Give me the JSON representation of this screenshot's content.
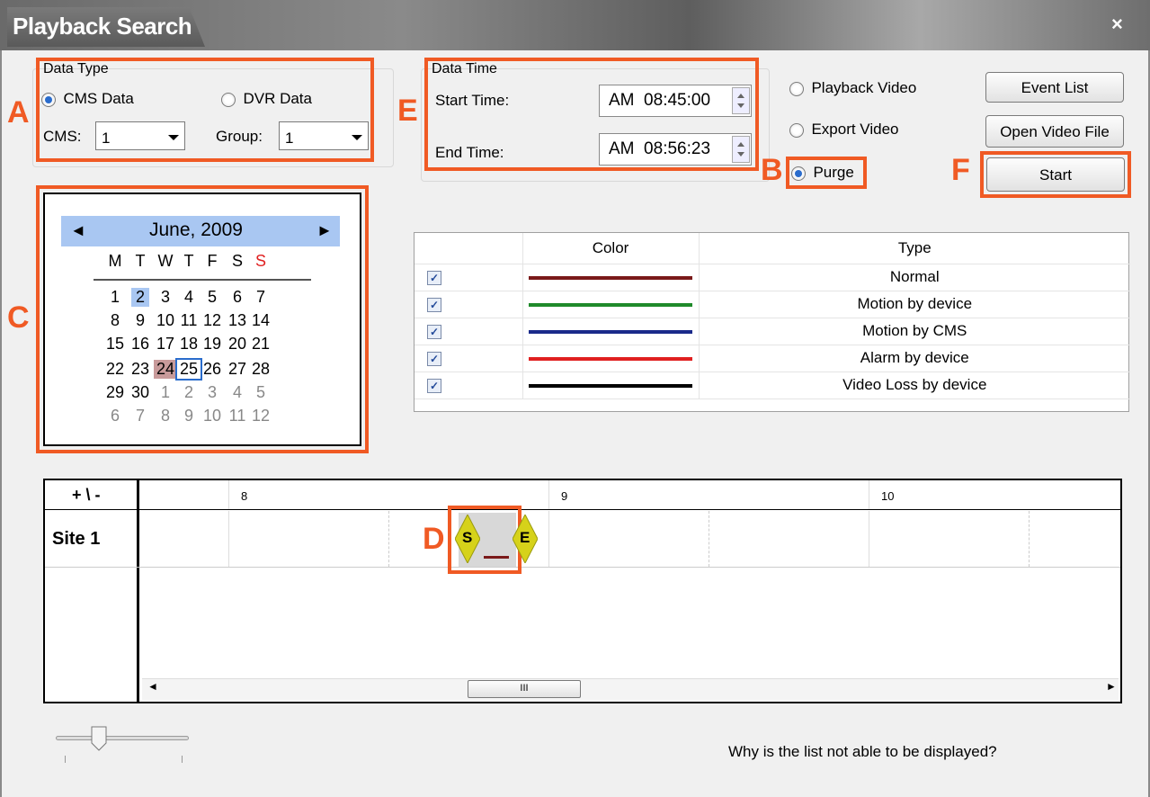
{
  "window": {
    "title": "Playback Search",
    "close": "×"
  },
  "data_type": {
    "legend": "Data Type",
    "cms_data": "CMS Data",
    "dvr_data": "DVR Data",
    "cms_label": "CMS:",
    "cms_value": "1",
    "group_label": "Group:",
    "group_value": "1"
  },
  "data_time": {
    "legend": "Data Time",
    "start_label": "Start Time:",
    "start_value": "AM  08:45:00",
    "end_label": "End Time:",
    "end_value": "AM  08:56:23"
  },
  "mode": {
    "playback": "Playback Video",
    "export": "Export Video",
    "purge": "Purge",
    "selected": "purge"
  },
  "buttons": {
    "event_list": "Event List",
    "open_video_file": "Open Video File",
    "start": "Start"
  },
  "calendar": {
    "month_label": "June, 2009",
    "prev": "◄",
    "next": "►",
    "days": [
      "M",
      "T",
      "W",
      "T",
      "F",
      "S",
      "S"
    ],
    "weeks": [
      [
        "1",
        "2",
        "3",
        "4",
        "5",
        "6",
        "7"
      ],
      [
        "8",
        "9",
        "10",
        "11",
        "12",
        "13",
        "14"
      ],
      [
        "15",
        "16",
        "17",
        "18",
        "19",
        "20",
        "21"
      ],
      [
        "22",
        "23",
        "24",
        "25",
        "26",
        "27",
        "28"
      ],
      [
        "29",
        "30",
        "1",
        "2",
        "3",
        "4",
        "5"
      ],
      [
        "6",
        "7",
        "8",
        "9",
        "10",
        "11",
        "12"
      ]
    ]
  },
  "legend_table": {
    "headers": [
      "",
      "Color",
      "Type"
    ],
    "rows": [
      {
        "type": "Normal",
        "color": "#7a1a1a"
      },
      {
        "type": "Motion by device",
        "color": "#1f8a2a"
      },
      {
        "type": "Motion by CMS",
        "color": "#1a2a8a"
      },
      {
        "type": "Alarm by device",
        "color": "#e02020"
      },
      {
        "type": "Video Loss by device",
        "color": "#000000"
      }
    ]
  },
  "timeline": {
    "zoom_label": "+ \\ -",
    "hours": [
      "8",
      "9",
      "10"
    ],
    "site": "Site 1",
    "start_marker": "S",
    "end_marker": "E",
    "scroll_thumb": "III",
    "scroll_left": "◄",
    "scroll_right": "►"
  },
  "annotations": {
    "a": "A",
    "b": "B",
    "c": "C",
    "d": "D",
    "e": "E",
    "f": "F"
  },
  "help_text": "Why is the list not able to be displayed?"
}
